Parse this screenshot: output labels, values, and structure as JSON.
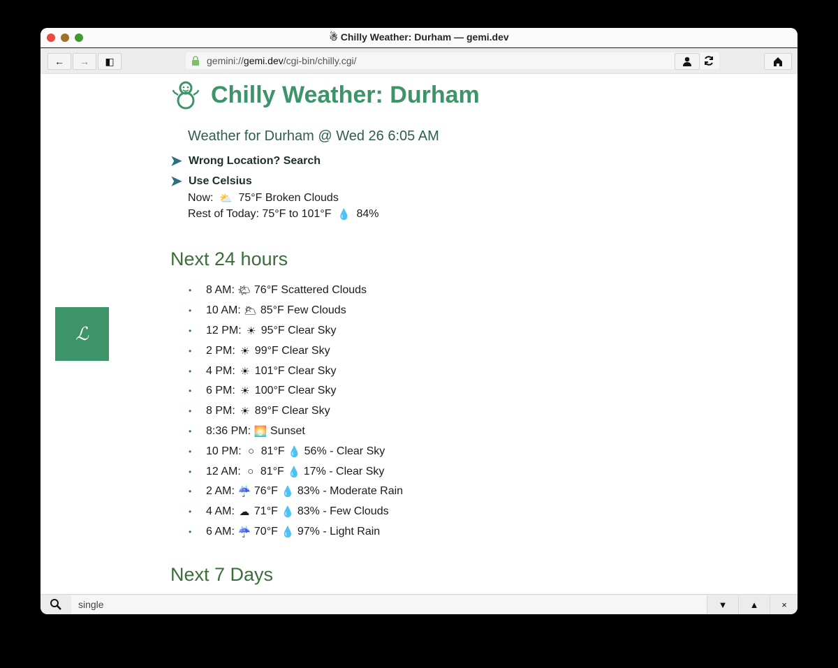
{
  "window": {
    "title": "Chilly Weather: Durham — gemi.dev",
    "title_icon": "snowman-icon"
  },
  "toolbar": {
    "back_icon": "←",
    "forward_icon": "→",
    "sidebar_icon": "◧",
    "url_scheme": "gemini://",
    "url_domain": "gemi.dev",
    "url_path": "/cgi-bin/chilly.cgi/",
    "identity_icon": "person-icon",
    "home_icon": "home-icon"
  },
  "page": {
    "title": "Chilly Weather: Durham",
    "subtitle": "Weather for Durham @ Wed 26 6:05 AM",
    "links": [
      {
        "label": "Wrong Location? Search"
      },
      {
        "label": "Use Celsius"
      }
    ],
    "now_label": "Now:",
    "now_icon": "⛅",
    "now_text": "75°F Broken Clouds",
    "rest_label": "Rest of Today: 75°F to 101°F",
    "rest_icon": "💧",
    "rest_precip": "84%",
    "section_24h": "Next 24 hours",
    "hours": [
      {
        "time": "8 AM:",
        "icon": "🌤",
        "text": "76°F Scattered Clouds"
      },
      {
        "time": "10 AM:",
        "icon": "🌥",
        "text": "85°F Few Clouds"
      },
      {
        "time": "12 PM:",
        "icon": "☀",
        "text": "95°F Clear Sky"
      },
      {
        "time": "2 PM:",
        "icon": "☀",
        "text": "99°F Clear Sky"
      },
      {
        "time": "4 PM:",
        "icon": "☀",
        "text": "101°F Clear Sky"
      },
      {
        "time": "6 PM:",
        "icon": "☀",
        "text": "100°F Clear Sky"
      },
      {
        "time": "8 PM:",
        "icon": "☀",
        "text": "89°F Clear Sky"
      },
      {
        "time": "8:36 PM:",
        "icon": "🌅",
        "text": "Sunset"
      },
      {
        "time": "10 PM:",
        "icon": "○",
        "text": "81°F",
        "drop": "💧",
        "extra": "56% - Clear Sky"
      },
      {
        "time": "12 AM:",
        "icon": "○",
        "text": "81°F",
        "drop": "💧",
        "extra": "17% - Clear Sky"
      },
      {
        "time": "2 AM:",
        "icon": "☔",
        "text": "76°F",
        "drop": "💧",
        "extra": "83% - Moderate Rain"
      },
      {
        "time": "4 AM:",
        "icon": "☁",
        "text": "71°F",
        "drop": "💧",
        "extra": "83% - Few Clouds"
      },
      {
        "time": "6 AM:",
        "icon": "☔",
        "text": "70°F",
        "drop": "💧",
        "extra": "97% - Light Rain"
      }
    ],
    "section_7d": "Next 7 Days"
  },
  "sidebar_tile": {
    "glyph": "ℒ"
  },
  "findbar": {
    "value": "single",
    "next_icon": "▼",
    "prev_icon": "▲",
    "close_icon": "×"
  }
}
